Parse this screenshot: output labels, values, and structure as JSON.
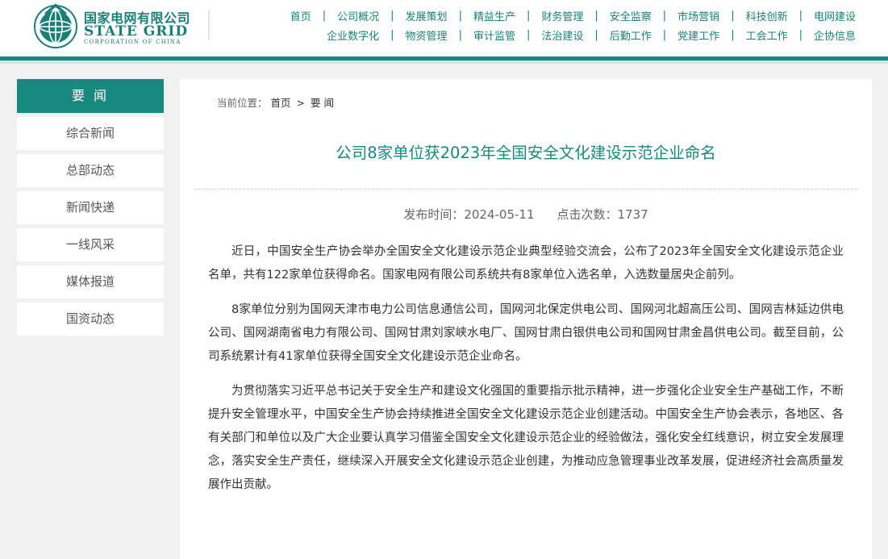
{
  "header": {
    "logo": {
      "name_cn": "国家电网有限公司",
      "name_en": "STATE GRID",
      "name_en_sub": "CORPORATION OF CHINA"
    },
    "nav_row1": [
      "首页",
      "公司概况",
      "发展策划",
      "精益生产",
      "财务管理",
      "安全监察",
      "市场营销",
      "科技创新",
      "电网建设"
    ],
    "nav_row2": [
      "企业数字化",
      "物资管理",
      "审计监管",
      "法治建设",
      "后勤工作",
      "党建工作",
      "工会工作",
      "企协信息"
    ],
    "separator": "|"
  },
  "sidebar": {
    "heading": "要 闻",
    "items": [
      "综合新闻",
      "总部动态",
      "新闻快递",
      "一线风采",
      "媒体报道",
      "国资动态"
    ]
  },
  "breadcrumb": {
    "prefix": "当前位置：",
    "home": "首页",
    "separator": ">",
    "current": "要 闻"
  },
  "article": {
    "title": "公司8家单位获2023年全国安全文化建设示范企业命名",
    "publish_label": "发布时间：2024-05-11",
    "views_label": "点击次数：1737",
    "paragraphs": [
      "近日，中国安全生产协会举办全国安全文化建设示范企业典型经验交流会，公布了2023年全国安全文化建设示范企业名单，共有122家单位获得命名。国家电网有限公司系统共有8家单位入选名单，入选数量居央企前列。",
      "8家单位分别为国网天津市电力公司信息通信公司，国网河北保定供电公司、国网河北超高压公司、国网吉林延边供电公司、国网湖南省电力有限公司、国网甘肃刘家峡水电厂、国网甘肃白银供电公司和国网甘肃金昌供电公司。截至目前，公司系统累计有41家单位获得全国安全文化建设示范企业命名。",
      "为贯彻落实习近平总书记关于安全生产和建设文化强国的重要指示批示精神，进一步强化企业安全生产基础工作，不断提升安全管理水平，中国安全生产协会持续推进全国安全文化建设示范企业创建活动。中国安全生产协会表示，各地区、各有关部门和单位以及广大企业要认真学习借鉴全国安全文化建设示范企业的经验做法，强化安全红线意识，树立安全发展理念，落实安全生产责任，继续深入开展安全文化建设示范企业创建，为推动应急管理事业改革发展，促进经济社会高质量发展作出贡献。"
    ]
  },
  "colors": {
    "brand_teal": "#17897f",
    "nav_text": "#1a7f78",
    "page_bg": "#f1f1f1"
  },
  "icons": {
    "logo": "state-grid-globe-emblem"
  }
}
